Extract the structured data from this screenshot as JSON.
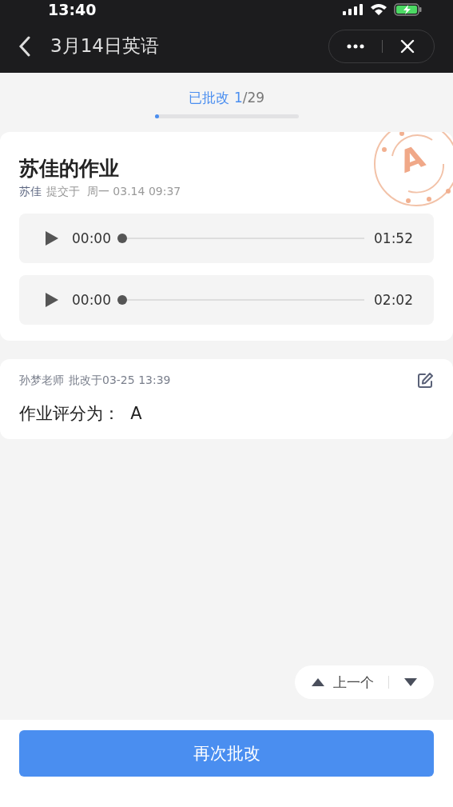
{
  "status_bar": {
    "time": "13:40"
  },
  "nav": {
    "title": "3月14日英语"
  },
  "progress": {
    "label": "已批改",
    "current": "1",
    "total": "/29",
    "level": 0.03
  },
  "submission": {
    "title": "苏佳的作业",
    "student": "苏佳",
    "submitted": "提交于  周一 03.14 09:37",
    "stamp_grade": "A",
    "audios": [
      {
        "elapsed": "00:00",
        "duration": "01:52",
        "level": 0
      },
      {
        "elapsed": "00:00",
        "duration": "02:02",
        "level": 0
      }
    ]
  },
  "review": {
    "teacher": "孙梦老师",
    "reviewed": "批改于03-25 13:39",
    "result": "作业评分为：  A"
  },
  "pager": {
    "prev": "上一个"
  },
  "action_button": "再次批改"
}
